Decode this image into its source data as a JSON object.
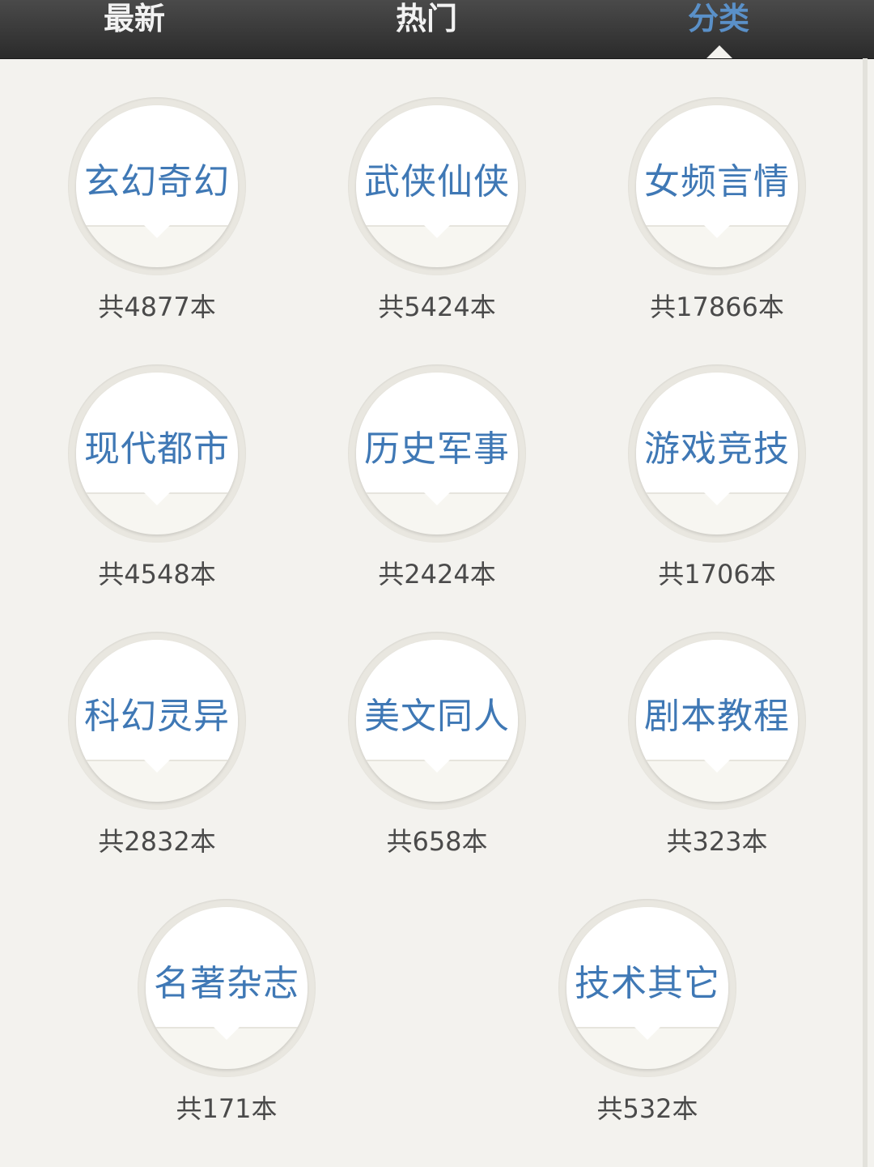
{
  "tabs": [
    {
      "label": "最新"
    },
    {
      "label": "热门"
    },
    {
      "label": "分类"
    }
  ],
  "active_tab": "分类",
  "accent_color": "#5a90c8",
  "categories": [
    {
      "name": "玄幻奇幻",
      "count": "共4877本"
    },
    {
      "name": "武侠仙侠",
      "count": "共5424本"
    },
    {
      "name": "女频言情",
      "count": "共17866本"
    },
    {
      "name": "现代都市",
      "count": "共4548本"
    },
    {
      "name": "历史军事",
      "count": "共2424本"
    },
    {
      "name": "游戏竞技",
      "count": "共1706本"
    },
    {
      "name": "科幻灵异",
      "count": "共2832本"
    },
    {
      "name": "美文同人",
      "count": "共658本"
    },
    {
      "name": "剧本教程",
      "count": "共323本"
    },
    {
      "name": "名著杂志",
      "count": "共171本"
    },
    {
      "name": "技术其它",
      "count": "共532本"
    }
  ]
}
